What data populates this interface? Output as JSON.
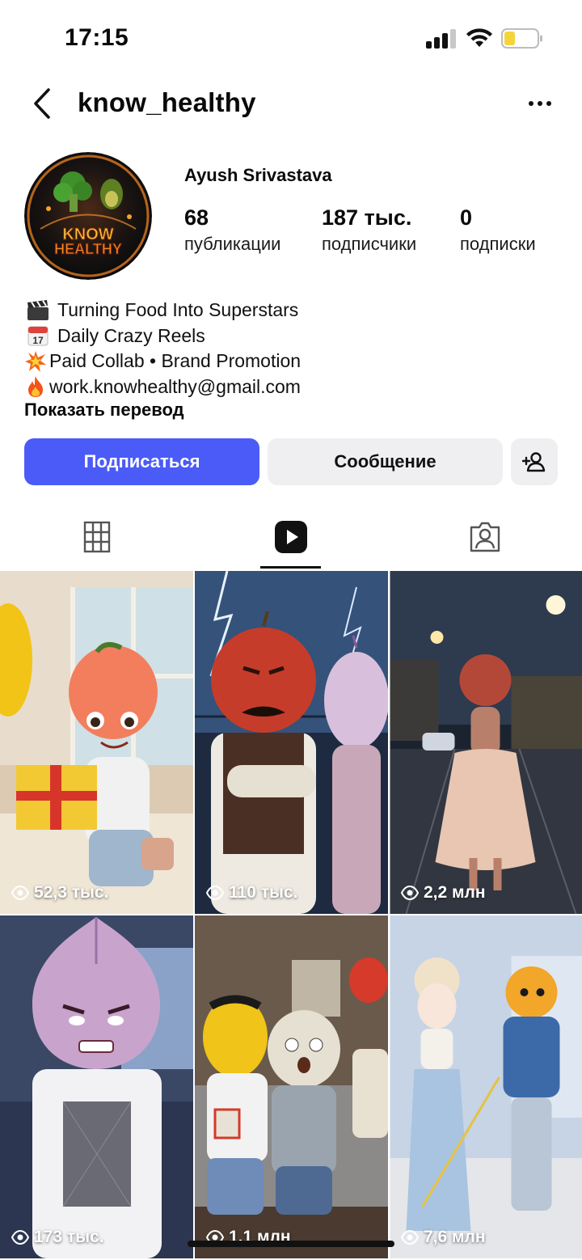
{
  "status_bar": {
    "time": "17:15"
  },
  "header": {
    "username": "know_healthy"
  },
  "profile": {
    "avatar_text": [
      "KNOW",
      "HEALTHY"
    ],
    "display_name": "Ayush Srivastava",
    "stats": [
      {
        "value": "68",
        "label": "публикации"
      },
      {
        "value": "187 тыс.",
        "label": "подписчики"
      },
      {
        "value": "0",
        "label": "подписки"
      }
    ],
    "bio": [
      {
        "emoji": "clapper-board",
        "text": "Turning Food Into Superstars"
      },
      {
        "emoji": "calendar",
        "text": "Daily Crazy Reels"
      },
      {
        "emoji": "collision",
        "text": "Paid Collab • Brand Promotion"
      },
      {
        "emoji": "fire",
        "text": "work.knowhealthy@gmail.com"
      }
    ],
    "show_translation": "Показать перевод"
  },
  "actions": {
    "follow": "Подписаться",
    "message": "Сообщение"
  },
  "tabs": {
    "active": "reels"
  },
  "reels": [
    {
      "views": "52,3 тыс."
    },
    {
      "views": "110 тыс."
    },
    {
      "views": "2,2 млн"
    },
    {
      "views": "173 тыс."
    },
    {
      "views": "1,1 млн"
    },
    {
      "views": "7,6 млн"
    }
  ],
  "colors": {
    "follow_button": "#4b5bf7",
    "secondary_button": "#efeff1",
    "battery_fill": "#f5d43b"
  }
}
